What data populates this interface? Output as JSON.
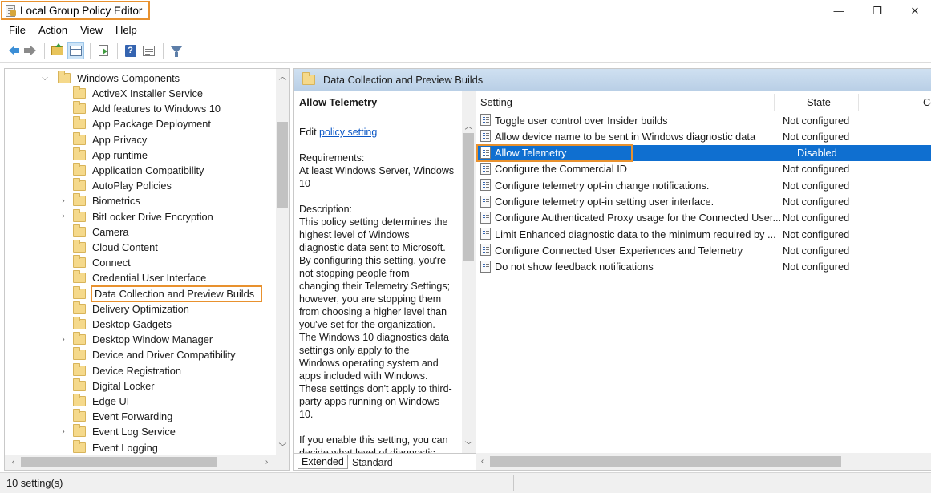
{
  "window": {
    "title": "Local Group Policy Editor",
    "controls": {
      "minimize": "—",
      "maximize": "❐",
      "close": "✕"
    },
    "accent_color": "#e8912e",
    "selection_color": "#0f6fd0"
  },
  "menu": [
    "File",
    "Action",
    "View",
    "Help"
  ],
  "toolbar": {
    "icons": [
      "back-icon",
      "forward-icon",
      "up-folder-icon",
      "show-tree-icon",
      "export-list-icon",
      "help-icon",
      "properties-icon",
      "filter-icon"
    ]
  },
  "tree": {
    "parent": "Windows Components",
    "items": [
      {
        "label": "ActiveX Installer Service",
        "expandable": false
      },
      {
        "label": "Add features to Windows 10",
        "expandable": false
      },
      {
        "label": "App Package Deployment",
        "expandable": false
      },
      {
        "label": "App Privacy",
        "expandable": false
      },
      {
        "label": "App runtime",
        "expandable": false
      },
      {
        "label": "Application Compatibility",
        "expandable": false
      },
      {
        "label": "AutoPlay Policies",
        "expandable": false
      },
      {
        "label": "Biometrics",
        "expandable": true
      },
      {
        "label": "BitLocker Drive Encryption",
        "expandable": true
      },
      {
        "label": "Camera",
        "expandable": false
      },
      {
        "label": "Cloud Content",
        "expandable": false
      },
      {
        "label": "Connect",
        "expandable": false
      },
      {
        "label": "Credential User Interface",
        "expandable": false
      },
      {
        "label": "Data Collection and Preview Builds",
        "expandable": false,
        "selected": true
      },
      {
        "label": "Delivery Optimization",
        "expandable": false
      },
      {
        "label": "Desktop Gadgets",
        "expandable": false
      },
      {
        "label": "Desktop Window Manager",
        "expandable": true
      },
      {
        "label": "Device and Driver Compatibility",
        "expandable": false
      },
      {
        "label": "Device Registration",
        "expandable": false
      },
      {
        "label": "Digital Locker",
        "expandable": false
      },
      {
        "label": "Edge UI",
        "expandable": false
      },
      {
        "label": "Event Forwarding",
        "expandable": false
      },
      {
        "label": "Event Log Service",
        "expandable": true
      },
      {
        "label": "Event Logging",
        "expandable": false
      }
    ]
  },
  "right_header": "Data Collection and Preview Builds",
  "description": {
    "title": "Allow Telemetry",
    "edit_prefix": "Edit ",
    "edit_link": "policy setting",
    "lines": [
      "Requirements:",
      "At least Windows Server, Windows",
      "10",
      "",
      "Description:",
      "This policy setting determines the",
      "highest level of Windows",
      "diagnostic data sent to Microsoft.",
      "By configuring this setting, you're",
      "not stopping people from",
      "changing their Telemetry Settings;",
      "however, you are stopping them",
      "from choosing a higher level than",
      "you've set for the organization.",
      "The Windows 10 diagnostics data",
      "settings only apply to the",
      "Windows operating system and",
      "apps included with Windows.",
      "These settings don't apply to third-",
      "party apps running on Windows",
      "10.",
      "",
      "If you enable this setting, you can",
      "decide what level of diagnostic"
    ]
  },
  "tabs": [
    "Extended",
    "Standard"
  ],
  "list": {
    "columns": [
      "Setting",
      "State",
      "Co"
    ],
    "rows": [
      {
        "name": "Toggle user control over Insider builds",
        "state": "Not configured"
      },
      {
        "name": "Allow device name to be sent in Windows diagnostic data",
        "state": "Not configured"
      },
      {
        "name": "Allow Telemetry",
        "state": "Disabled",
        "selected": true
      },
      {
        "name": "Configure the Commercial ID",
        "state": "Not configured"
      },
      {
        "name": "Configure telemetry opt-in change notifications.",
        "state": "Not configured"
      },
      {
        "name": "Configure telemetry opt-in setting user interface.",
        "state": "Not configured"
      },
      {
        "name": "Configure Authenticated Proxy usage for the Connected User...",
        "state": "Not configured"
      },
      {
        "name": "Limit Enhanced diagnostic data to the minimum required by ...",
        "state": "Not configured"
      },
      {
        "name": "Configure Connected User Experiences and Telemetry",
        "state": "Not configured"
      },
      {
        "name": "Do not show feedback notifications",
        "state": "Not configured"
      }
    ]
  },
  "status": "10 setting(s)"
}
